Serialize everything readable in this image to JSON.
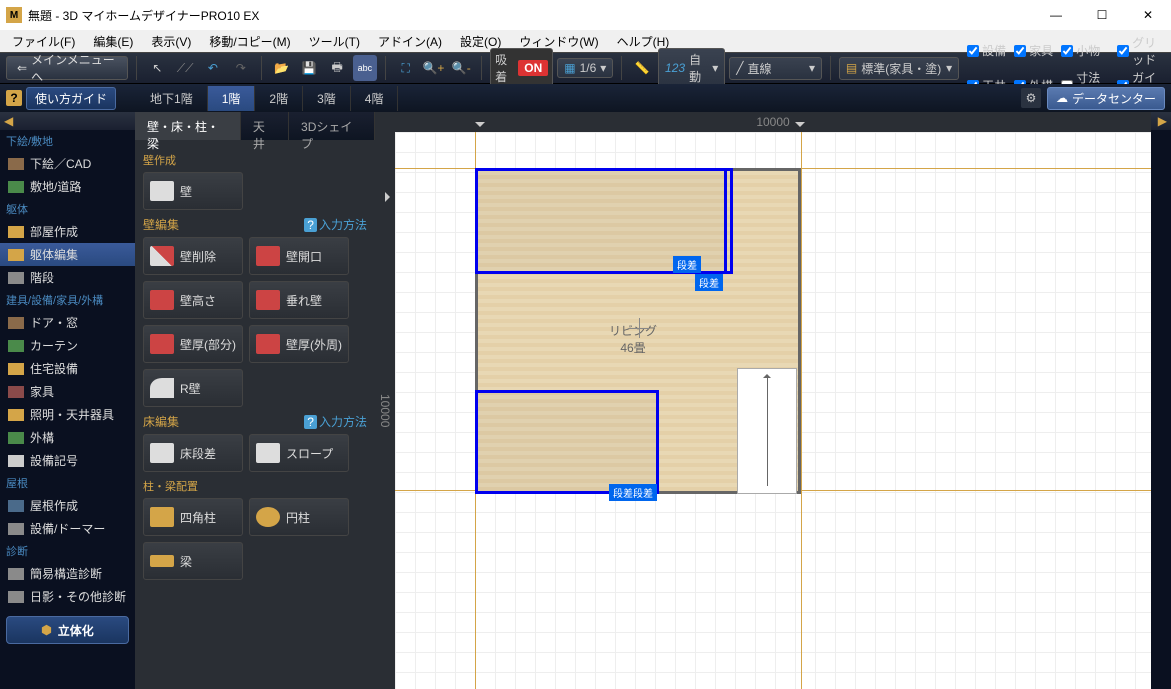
{
  "titlebar": {
    "icon": "M",
    "title": "無題 - 3D マイホームデザイナーPRO10 EX"
  },
  "winbtns": {
    "min": "—",
    "max": "☐",
    "close": "✕"
  },
  "menubar": [
    "ファイル(F)",
    "編集(E)",
    "表示(V)",
    "移動/コピー(M)",
    "ツール(T)",
    "アドイン(A)",
    "設定(O)",
    "ウィンドウ(W)",
    "ヘルプ(H)"
  ],
  "toolbar": {
    "mainmenu": "メインメニューへ",
    "snap_label": "吸着",
    "snap_on": "ON",
    "grid_ratio": "1/6",
    "auto_label": "自動",
    "line_label": "直線",
    "layer_label": "標準(家具・塗)"
  },
  "checks": {
    "equipment": "設備",
    "furniture": "家具",
    "small": "小物",
    "grid": "グリッド",
    "ceiling": "天井",
    "exterior": "外構",
    "dimension": "寸法線",
    "guideline": "ガイド線"
  },
  "row2": {
    "help": "?",
    "guide": "使い方ガイド",
    "floors": [
      "地下1階",
      "1階",
      "2階",
      "3階",
      "4階"
    ],
    "active_floor": 1,
    "datacenter": "データセンター"
  },
  "leftnav": {
    "sections": {
      "shitae": "下絵/敷地",
      "kutai": "躯体",
      "tategu": "建具/設備/家具/外構",
      "yane": "屋根",
      "shindan": "診断"
    },
    "items": {
      "cad": "下絵／CAD",
      "site": "敷地/道路",
      "room": "部屋作成",
      "edit": "躯体編集",
      "stair": "階段",
      "door": "ドア・窓",
      "curtain": "カーテン",
      "housing": "住宅設備",
      "furniture": "家具",
      "lighting": "照明・天井器具",
      "exterior": "外構",
      "symbol": "設備記号",
      "roof": "屋根作成",
      "dormer": "設備/ドーマー",
      "kani": "簡易構造診断",
      "hikage": "日影・その他診断"
    },
    "make3d": "立体化"
  },
  "palette": {
    "tabs": [
      "壁・床・柱・梁",
      "天井",
      "3Dシェイプ"
    ],
    "active_tab": 0,
    "sec_wall_create": "壁作成",
    "sec_wall_edit": "壁編集",
    "sec_floor_edit": "床編集",
    "sec_column": "柱・梁配置",
    "input_help": "入力方法",
    "help_q": "?",
    "btns": {
      "wall": "壁",
      "wall_delete": "壁削除",
      "wall_opening": "壁開口",
      "wall_height": "壁高さ",
      "hang_wall": "垂れ壁",
      "wall_thick_part": "壁厚(部分)",
      "wall_thick_out": "壁厚(外周)",
      "r_wall": "R壁",
      "floor_step": "床段差",
      "slope": "スロープ",
      "sq_column": "四角柱",
      "rd_column": "円柱",
      "beam": "梁"
    }
  },
  "canvas": {
    "ruler_h": "10000",
    "ruler_v": "10000",
    "room_label": "リビング",
    "room_size": "46畳",
    "step": "段差",
    "step2": "段差",
    "step_bottom": "段差段差"
  }
}
